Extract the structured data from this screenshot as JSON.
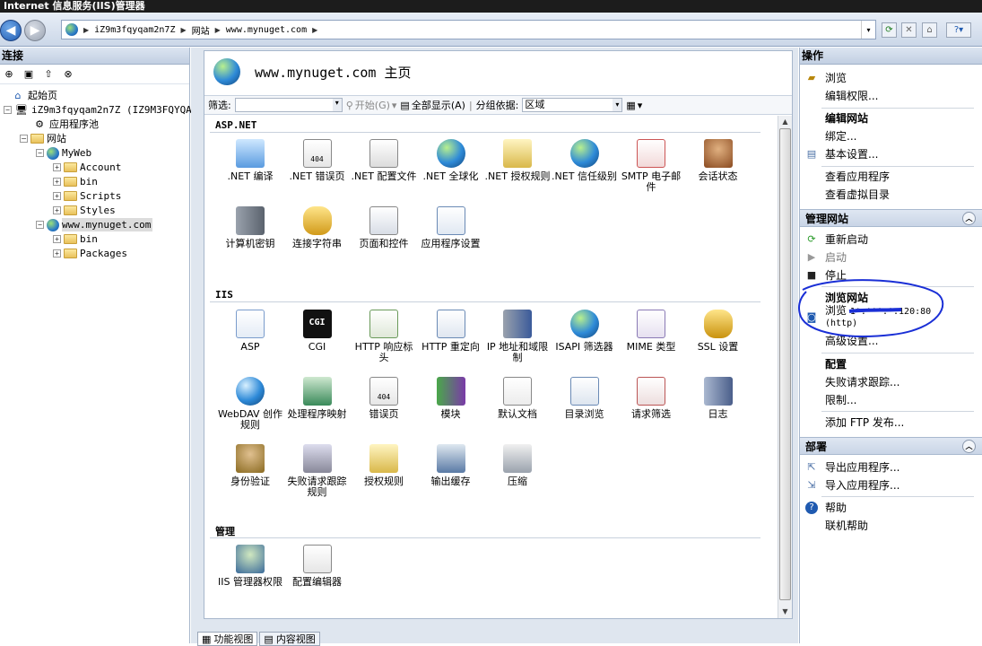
{
  "window": {
    "title": "Internet 信息服务(IIS)管理器"
  },
  "address": {
    "segments": [
      "iZ9m3fqyqam2n7Z",
      "网站",
      "www.mynuget.com"
    ]
  },
  "connections": {
    "header": "连接",
    "tree": [
      {
        "label": "起始页",
        "level": 0
      },
      {
        "label": "iZ9m3fqyqam2n7Z (IZ9M3FQYQAM",
        "level": 0
      },
      {
        "label": "应用程序池",
        "level": 1
      },
      {
        "label": "网站",
        "level": 1
      },
      {
        "label": "MyWeb",
        "level": 2
      },
      {
        "label": "Account",
        "level": 3
      },
      {
        "label": "bin",
        "level": 3
      },
      {
        "label": "Scripts",
        "level": 3
      },
      {
        "label": "Styles",
        "level": 3
      },
      {
        "label": "www.mynuget.com",
        "level": 2
      },
      {
        "label": "bin",
        "level": 3
      },
      {
        "label": "Packages",
        "level": 3
      }
    ]
  },
  "main": {
    "title": "www.mynuget.com 主页",
    "filter": {
      "label": "筛选:",
      "start": "开始(G)",
      "show_all": "全部显示(A)",
      "group_by": "分组依据:",
      "group_value": "区域"
    },
    "sections": [
      {
        "title": "ASP.NET",
        "items": [
          ".NET 编译",
          ".NET 错误页",
          ".NET 配置文件",
          ".NET 全球化",
          ".NET 授权规则",
          ".NET 信任级别",
          "SMTP 电子邮件",
          "会话状态",
          "计算机密钥",
          "连接字符串",
          "页面和控件",
          "应用程序设置"
        ]
      },
      {
        "title": "IIS",
        "items": [
          "ASP",
          "CGI",
          "HTTP 响应标头",
          "HTTP 重定向",
          "IP 地址和域限制",
          "ISAPI 筛选器",
          "MIME 类型",
          "SSL 设置",
          "WebDAV 创作规则",
          "处理程序映射",
          "错误页",
          "模块",
          "默认文档",
          "目录浏览",
          "请求筛选",
          "日志",
          "身份验证",
          "失败请求跟踪规则",
          "授权规则",
          "输出缓存",
          "压缩"
        ]
      },
      {
        "title": "管理",
        "items": [
          "IIS 管理器权限",
          "配置编辑器"
        ]
      }
    ],
    "cgi_badge": "CGI",
    "err_badge": "404",
    "tabs": [
      "功能视图",
      "内容视图"
    ]
  },
  "actions": {
    "header": "操作",
    "browse": "浏览",
    "edit_perms": "编辑权限...",
    "edit_site_head": "编辑网站",
    "bindings": "绑定...",
    "basic_settings": "基本设置...",
    "view_apps": "查看应用程序",
    "view_vdirs": "查看虚拟目录",
    "manage_head": "管理网站",
    "restart": "重新启动",
    "start": "启动",
    "stop": "停止",
    "browse_site_head": "浏览网站",
    "browse_prefix": "浏览",
    "browse_addr": "1*.***.*.120:80",
    "browse_suffix": "(http)",
    "advanced": "高级设置...",
    "config_head": "配置",
    "failed_req": "失败请求跟踪...",
    "limits": "限制...",
    "add_ftp": "添加 FTP 发布...",
    "deploy_head": "部署",
    "export_app": "导出应用程序...",
    "import_app": "导入应用程序...",
    "help": "帮助",
    "online_help": "联机帮助"
  },
  "colors": {
    "accent": "#1f5ab0",
    "annotation": "#1a2fd6",
    "header_bg": "#c9d5e6"
  }
}
